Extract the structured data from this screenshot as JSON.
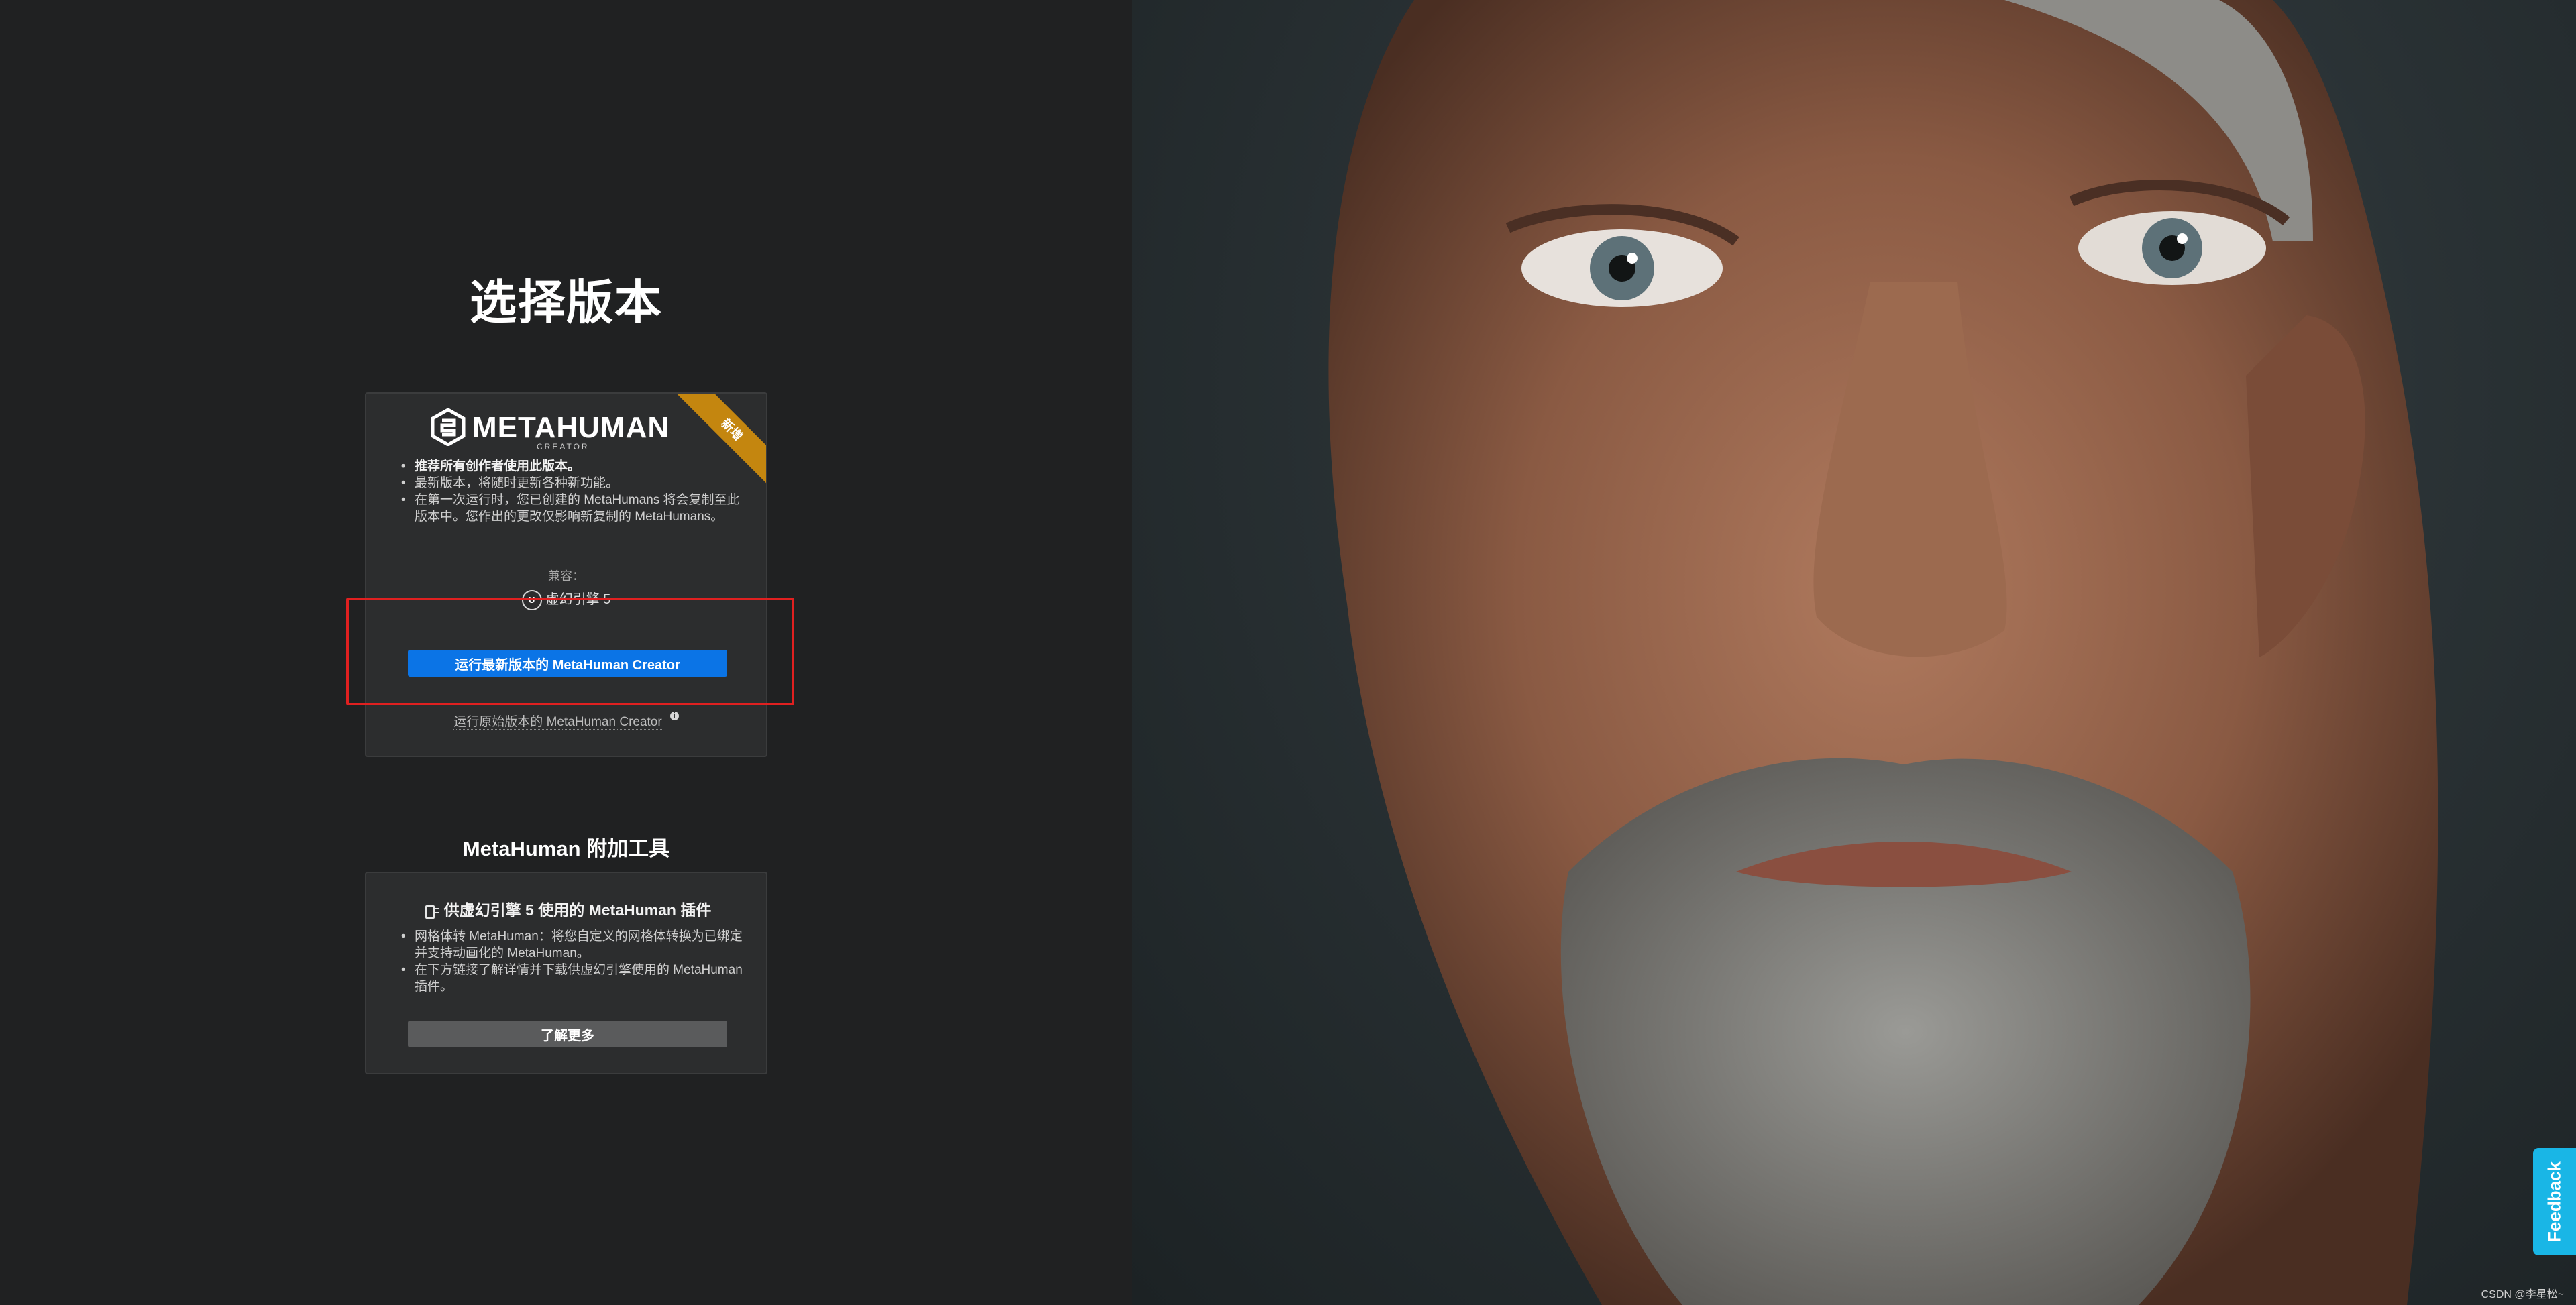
{
  "page": {
    "title": "选择版本"
  },
  "main_card": {
    "logo_word": "METAHUMAN",
    "logo_sub": "CREATOR",
    "ribbon": "新增",
    "bullets": [
      "推荐所有创作者使用此版本。",
      "最新版本，将随时更新各种新功能。",
      "在第一次运行时，您已创建的 MetaHumans 将会复制至此版本中。您作出的更改仅影响新复制的 MetaHumans。"
    ],
    "compat_label": "兼容：",
    "compat_engine": "虚幻引擎 5",
    "primary_button": "运行最新版本的 MetaHuman Creator",
    "legacy_link": "运行原始版本的 MetaHuman Creator"
  },
  "addons": {
    "section_title": "MetaHuman 附加工具",
    "card_title": "供虚幻引擎 5 使用的 MetaHuman 插件",
    "bullets": [
      "网格体转 MetaHuman：将您自定义的网格体转换为已绑定并支持动画化的 MetaHuman。",
      "在下方链接了解详情并下载供虚幻引擎使用的 MetaHuman 插件。"
    ],
    "button": "了解更多"
  },
  "feedback": {
    "label": "Feedback"
  },
  "watermark": "CSDN @李星松~",
  "colors": {
    "primary": "#0b74e6",
    "highlight": "#e02020",
    "ribbon": "#c4860f",
    "feedback": "#19b6e6"
  }
}
